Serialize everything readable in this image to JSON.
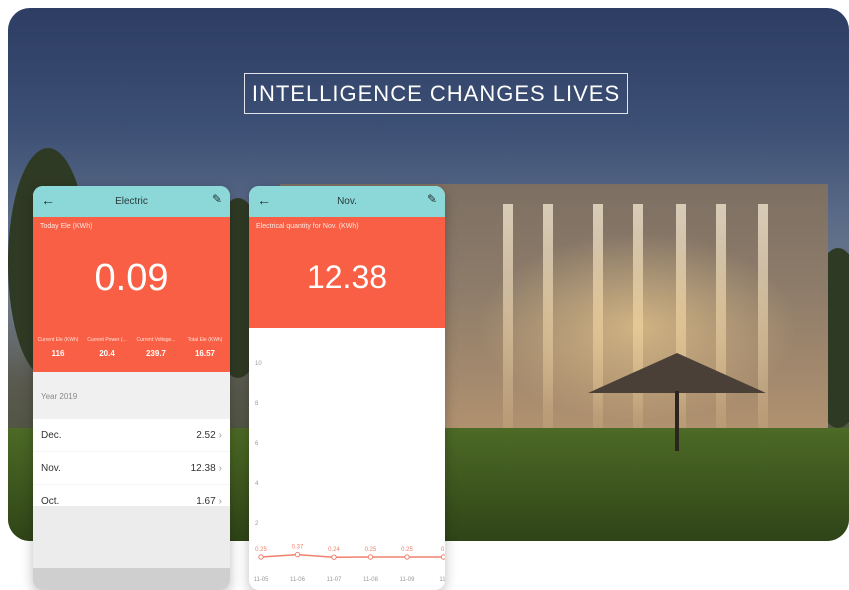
{
  "banner": {
    "title": "INTELLIGENCE CHANGES LIVES"
  },
  "phone_electric": {
    "nav_title": "Electric",
    "today_label": "Today Ele (KWh)",
    "today_value": "0.09",
    "stats": [
      {
        "label": "Current Ele (KWh)",
        "value": "116"
      },
      {
        "label": "Current Power (...",
        "value": "20.4"
      },
      {
        "label": "Current Voltage...",
        "value": "239.7"
      },
      {
        "label": "Total Ele (KWh)",
        "value": "16.57"
      }
    ],
    "year_label": "Year 2019",
    "months": [
      {
        "name": "Dec.",
        "value": "2.52"
      },
      {
        "name": "Nov.",
        "value": "12.38"
      },
      {
        "name": "Oct.",
        "value": "1.67"
      }
    ]
  },
  "phone_nov": {
    "nav_title": "Nov.",
    "quantity_label": "Electrical quantity for Nov. (KWh)",
    "quantity_value": "12.38"
  },
  "chart_data": {
    "type": "line",
    "x": [
      "11-05",
      "11-06",
      "11-07",
      "11-08",
      "11-09",
      "11-"
    ],
    "values": [
      0.25,
      0.37,
      0.24,
      0.25,
      0.25,
      0.25
    ],
    "data_labels": [
      "0.25",
      "0.37",
      "0.24",
      "0.25",
      "0.25",
      "0."
    ],
    "y_ticks": [
      "10",
      "8",
      "6",
      "4",
      "2"
    ],
    "ylim": [
      0,
      10
    ],
    "line_color": "#f0806e",
    "grid": false
  },
  "colors": {
    "accent_orange": "#f85f44",
    "nav_teal": "#8cd8d8"
  }
}
